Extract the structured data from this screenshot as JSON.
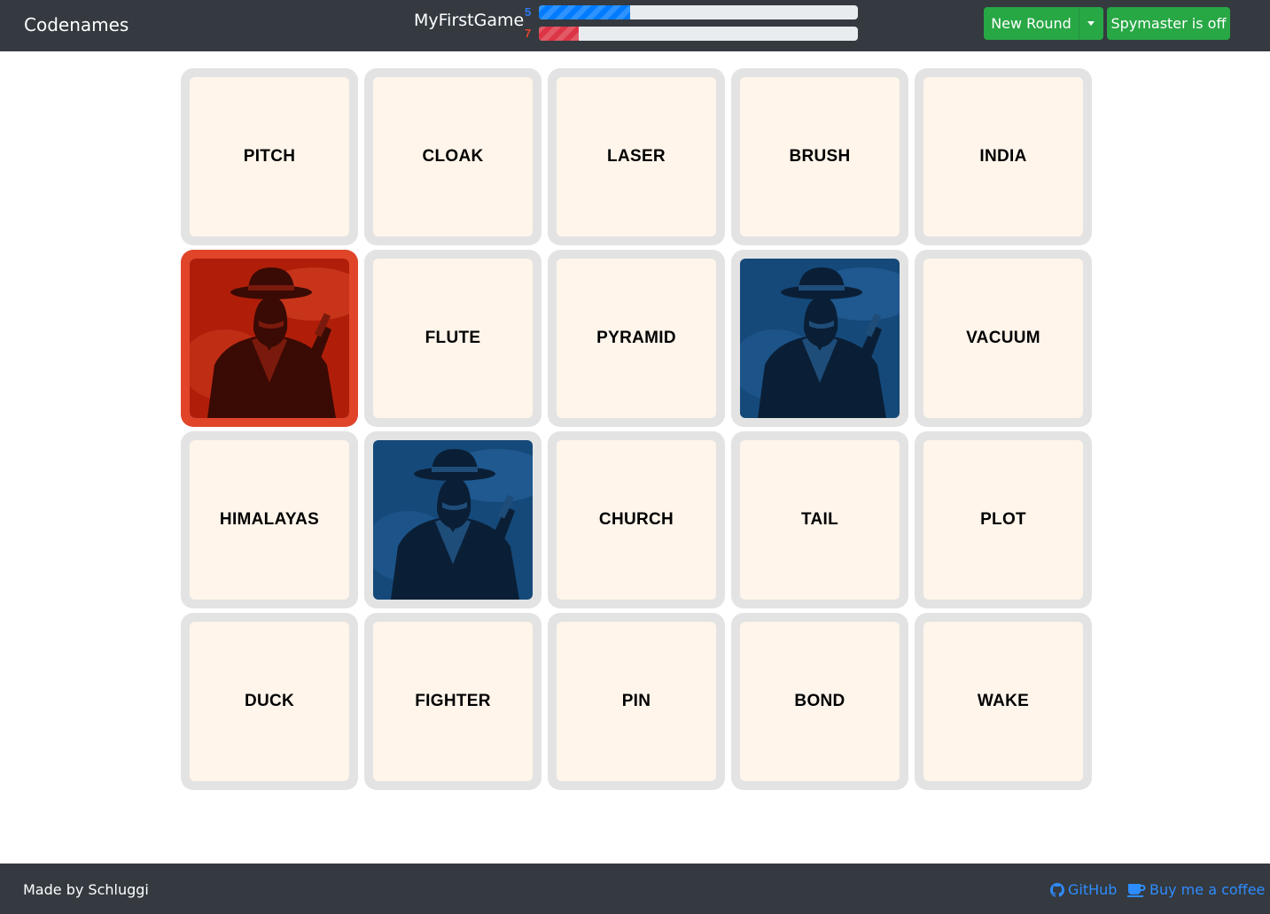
{
  "navbar": {
    "brand": "Codenames",
    "game_name": "MyFirstGame",
    "scores": {
      "blue": {
        "remaining": "5",
        "progress_fraction": 0.286,
        "color": "#007bff"
      },
      "red": {
        "remaining": "7",
        "progress_fraction": 0.125,
        "color": "#dc3545"
      }
    },
    "new_round_label": "New Round",
    "spymaster_label": "Spymaster is off"
  },
  "board": {
    "cards": [
      {
        "word": "PITCH",
        "revealed": null
      },
      {
        "word": "CLOAK",
        "revealed": null
      },
      {
        "word": "LASER",
        "revealed": null
      },
      {
        "word": "BRUSH",
        "revealed": null
      },
      {
        "word": "INDIA",
        "revealed": null
      },
      {
        "word": "",
        "revealed": "red"
      },
      {
        "word": "FLUTE",
        "revealed": null
      },
      {
        "word": "PYRAMID",
        "revealed": null
      },
      {
        "word": "",
        "revealed": "blue"
      },
      {
        "word": "VACUUM",
        "revealed": null
      },
      {
        "word": "HIMALAYAS",
        "revealed": null
      },
      {
        "word": "",
        "revealed": "blue"
      },
      {
        "word": "CHURCH",
        "revealed": null
      },
      {
        "word": "TAIL",
        "revealed": null
      },
      {
        "word": "PLOT",
        "revealed": null
      },
      {
        "word": "DUCK",
        "revealed": null
      },
      {
        "word": "FIGHTER",
        "revealed": null
      },
      {
        "word": "PIN",
        "revealed": null
      },
      {
        "word": "BOND",
        "revealed": null
      },
      {
        "word": "WAKE",
        "revealed": null
      }
    ]
  },
  "footer": {
    "made_by": "Made by Schluggi",
    "github_label": "GitHub",
    "coffee_label": "Buy me a coffee"
  },
  "icons": {
    "github": "github-icon",
    "coffee": "coffee-icon",
    "caret": "caret-down-icon",
    "red_agent": "red-agent-icon",
    "blue_agent": "blue-agent-icon"
  }
}
